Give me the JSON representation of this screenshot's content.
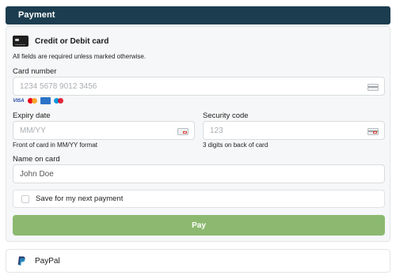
{
  "header": {
    "title": "Payment"
  },
  "card_method": {
    "label": "Credit or Debit card",
    "icon": "credit-card-icon"
  },
  "form": {
    "required_note": "All fields are required unless marked otherwise.",
    "card_number": {
      "label": "Card number",
      "placeholder": "1234 5678 9012 3456"
    },
    "brands": {
      "visa": "VISA"
    },
    "expiry": {
      "label": "Expiry date",
      "placeholder": "MM/YY",
      "hint": "Front of card in MM/YY format"
    },
    "security": {
      "label": "Security code",
      "placeholder": "123",
      "hint": "3 digits on back of card"
    },
    "name": {
      "label": "Name on card",
      "value": "John Doe"
    },
    "save": {
      "label": "Save for my next payment",
      "checked": false
    },
    "pay_label": "Pay"
  },
  "paypal": {
    "label": "PayPal",
    "icon": "paypal-icon"
  },
  "colors": {
    "header_bg": "#1c3d4f",
    "pay_button": "#8cb96f",
    "panel_bg": "#f6f7f8"
  }
}
